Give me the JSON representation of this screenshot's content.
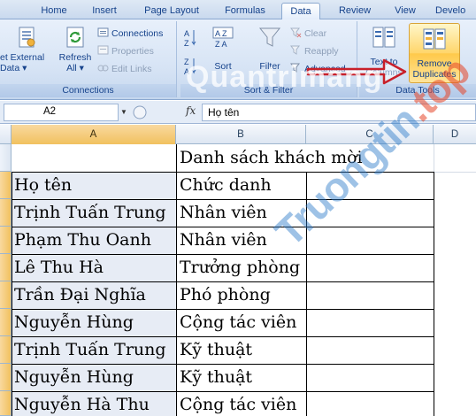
{
  "ribbon_tabs": [
    "Home",
    "Insert",
    "Page Layout",
    "Formulas",
    "Data",
    "Review",
    "View",
    "Develo"
  ],
  "active_tab": "Data",
  "connections_group": {
    "get_external_line1": "et External",
    "get_external_line2": "Data ▾",
    "refresh_line1": "Refresh",
    "refresh_line2": "All ▾",
    "connections": "Connections",
    "properties": "Properties",
    "edit_links": "Edit Links",
    "label": "Connections"
  },
  "sort_filter_group": {
    "sort": "Sort",
    "filter": "Filter",
    "clear": "Clear",
    "reapply": "Reapply",
    "advanced": "Advanced",
    "label": "Sort & Filter"
  },
  "data_tools_group": {
    "text_to_columns_line1": "Text to",
    "text_to_columns_line2": "Columns",
    "remove_duplicates_line1": "Remove",
    "remove_duplicates_line2": "Duplicates",
    "label": "Data Tools"
  },
  "formula_bar": {
    "name_box": "A2",
    "fx": "fx",
    "content": "Họ tên"
  },
  "columns": [
    "A",
    "B",
    "C",
    "D"
  ],
  "sheet": {
    "title": "Danh sách khách mời",
    "rows": [
      {
        "a": "Họ tên",
        "b": "Chức danh"
      },
      {
        "a": "Trịnh Tuấn Trung",
        "b": "Nhân viên"
      },
      {
        "a": "Phạm Thu Oanh",
        "b": "Nhân viên"
      },
      {
        "a": "Lê Thu Hà",
        "b": "Trưởng phòng"
      },
      {
        "a": "Trần Đại Nghĩa",
        "b": "Phó phòng"
      },
      {
        "a": "Nguyễn Hùng",
        "b": "Cộng tác viên"
      },
      {
        "a": "Trịnh Tuấn Trung",
        "b": "Kỹ thuật"
      },
      {
        "a": "Nguyễn Hùng",
        "b": "Kỹ thuật"
      },
      {
        "a": "Nguyễn Hà Thu",
        "b": "Cộng tác viên"
      }
    ]
  },
  "watermark": {
    "site_part1": "Truongtin",
    "site_part2": ".top",
    "ribbon_mark": "Quantrimang"
  },
  "colors": {
    "ribbon_text": "#15428b",
    "selected_header": "#f1c15f",
    "arrow": "#c8202a"
  }
}
